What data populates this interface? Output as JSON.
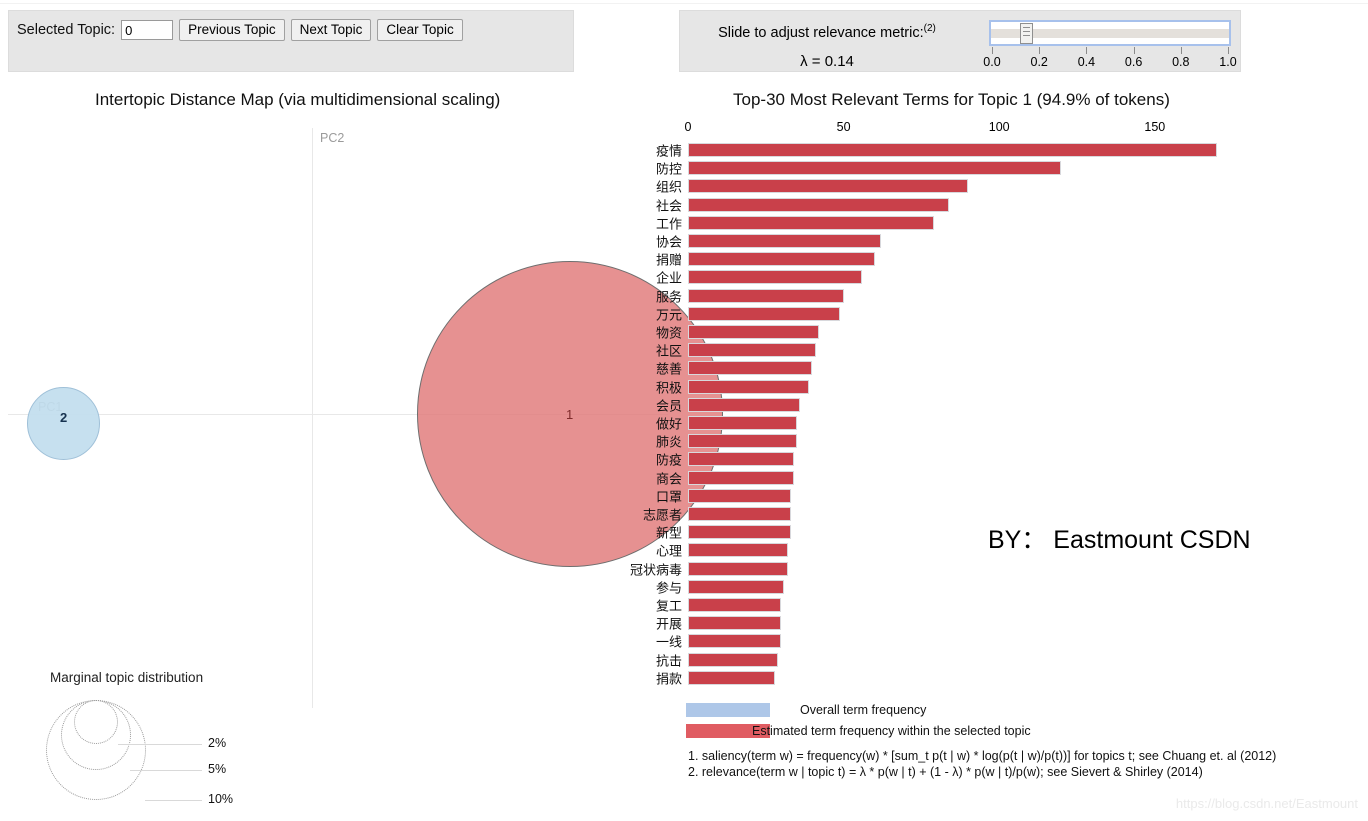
{
  "topic_panel": {
    "label": "Selected Topic:",
    "input_value": "0",
    "buttons": [
      {
        "name": "previous-topic-button",
        "label": "Previous Topic"
      },
      {
        "name": "next-topic-button",
        "label": "Next Topic"
      },
      {
        "name": "clear-topic-button",
        "label": "Clear Topic"
      }
    ]
  },
  "lambda_panel": {
    "slide_label": "Slide to adjust relevance metric:",
    "slide_superscript": "(2)",
    "lambda_text": "λ = 0.14",
    "lambda_value": 0.14,
    "slider": {
      "min": 0.0,
      "max": 1.0,
      "value": 0.14,
      "tick_labels": [
        "0.0",
        "0.2",
        "0.4",
        "0.6",
        "0.8",
        "1.0"
      ],
      "tick_values": [
        0.0,
        0.2,
        0.4,
        0.6,
        0.8,
        1.0
      ]
    }
  },
  "left_panel": {
    "title": "Intertopic Distance Map (via multidimensional scaling)",
    "axis_y_label": "PC2",
    "axis_x_label": "PC1",
    "topics": [
      {
        "id": "1",
        "label": "1",
        "selected": true
      },
      {
        "id": "2",
        "label": "2",
        "selected": false
      }
    ],
    "marginal_title": "Marginal topic distribution",
    "marginal_labels": [
      "2%",
      "5%",
      "10%"
    ]
  },
  "right_panel": {
    "title": "Top-30 Most Relevant Terms for Topic 1 (94.9% of tokens)",
    "legend": {
      "overall": "Overall term frequency",
      "estimated": "Estimated term frequency within the selected topic"
    },
    "footnotes": [
      "1. saliency(term w) = frequency(w) * [sum_t p(t | w) * log(p(t | w)/p(t))] for topics t; see Chuang et. al (2012)",
      "2. relevance(term w | topic t) = λ * p(w | t) + (1 - λ) * p(w | t)/p(w); see Sievert & Shirley (2014)"
    ]
  },
  "byline": "BY： Eastmount CSDN",
  "watermark": "https://blog.csdn.net/Eastmount",
  "colors": {
    "estimated_bar": "#c9404a",
    "overall_bar": "#aec7e8",
    "selected_topic_circle": "#e07979",
    "other_topic_circle": "#c1ddee",
    "panel_background": "#e6e6e6",
    "slider_accent": "#a7c1ec"
  },
  "chart_data": {
    "type": "bar",
    "orientation": "horizontal",
    "title": "Top-30 Most Relevant Terms for Topic 1 (94.9% of tokens)",
    "xlabel": "",
    "ylabel": "",
    "xlim": [
      0,
      170
    ],
    "xticks": [
      0,
      50,
      100,
      150
    ],
    "grid": false,
    "legend_position": "bottom-left",
    "categories": [
      "疫情",
      "防控",
      "组织",
      "社会",
      "工作",
      "协会",
      "捐赠",
      "企业",
      "服务",
      "万元",
      "物资",
      "社区",
      "慈善",
      "积极",
      "会员",
      "做好",
      "肺炎",
      "防疫",
      "商会",
      "口罩",
      "志愿者",
      "新型",
      "心理",
      "冠状病毒",
      "参与",
      "复工",
      "开展",
      "一线",
      "抗击",
      "捐款"
    ],
    "series": [
      {
        "name": "Estimated term frequency within the selected topic",
        "color": "#c9404a",
        "values": [
          170,
          120,
          90,
          84,
          79,
          62,
          60,
          56,
          50,
          49,
          42,
          41,
          40,
          39,
          36,
          35,
          35,
          34,
          34,
          33,
          33,
          33,
          32,
          32,
          31,
          30,
          30,
          30,
          29,
          28
        ]
      },
      {
        "name": "Overall term frequency",
        "color": "#aec7e8",
        "values": [
          170,
          120,
          90,
          84,
          79,
          62,
          60,
          56,
          50,
          49,
          42,
          41,
          40,
          39,
          36,
          35,
          35,
          34,
          34,
          33,
          33,
          33,
          32,
          32,
          31,
          30,
          30,
          30,
          29,
          28
        ]
      }
    ]
  }
}
